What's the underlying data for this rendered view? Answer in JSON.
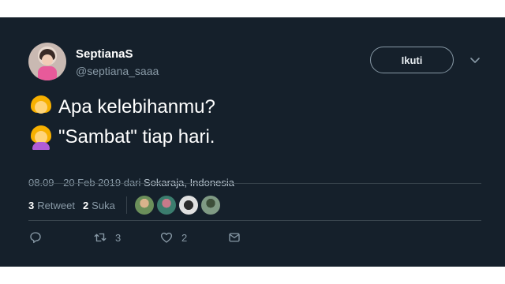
{
  "user": {
    "name": "SeptianaS",
    "handle": "@septiana_saaa"
  },
  "follow_label": "Ikuti",
  "text": {
    "line1": "Apa kelebihanmu?",
    "line2": "\"Sambat\" tiap hari."
  },
  "meta": {
    "time_date": "08.09 - 20 Feb 2019",
    "from": "dari",
    "location": "Sokaraja, Indonesia"
  },
  "stats": {
    "retweets": "3",
    "retweet_label": "Retweet",
    "likes": "2",
    "like_label": "Suka"
  },
  "actions": {
    "retweet_count": "3",
    "like_count": "2"
  },
  "colors": {
    "background": "#15202b",
    "secondary_text": "#8899a6",
    "primary_text": "#ffffff"
  }
}
